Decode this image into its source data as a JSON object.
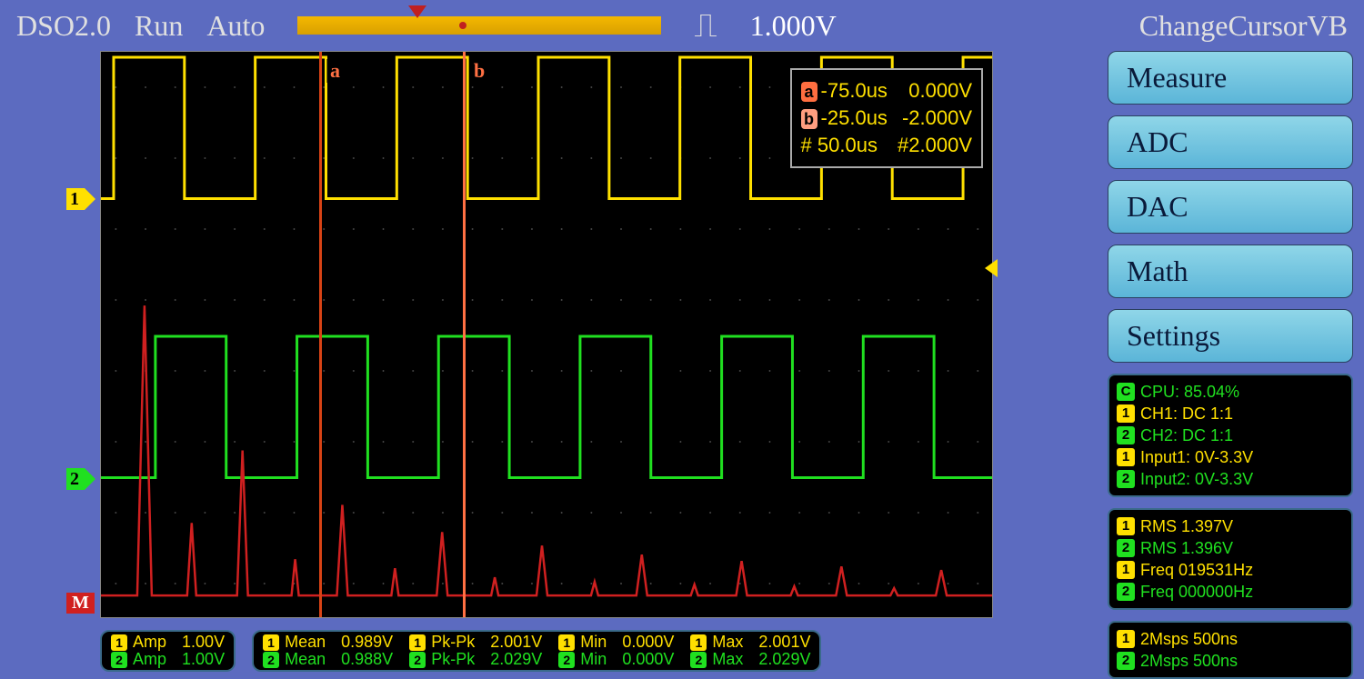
{
  "top": {
    "title": "DSO2.0",
    "run": "Run",
    "auto": "Auto",
    "trig_level": "1.000V",
    "cursor_mode": "ChangeCursorVB"
  },
  "side_buttons": {
    "measure": "Measure",
    "adc": "ADC",
    "dac": "DAC",
    "math": "Math",
    "settings": "Settings"
  },
  "cursors": {
    "a_label": "a",
    "b_label": "b",
    "a_time": "-75.0us",
    "a_volt": "0.000V",
    "b_time": "-25.0us",
    "b_volt": "-2.000V",
    "delta_time": "50.0us",
    "delta_volt": "#2.000V",
    "hash": "#"
  },
  "markers": {
    "ch1": "1",
    "ch2": "2",
    "math": "M"
  },
  "status_box": {
    "cpu": "CPU: 85.04%",
    "ch1": "CH1: DC 1:1",
    "ch2": "CH2: DC 1:1",
    "in1": "Input1: 0V-3.3V",
    "in2": "Input2: 0V-3.3V"
  },
  "meas_box": {
    "rms1": "RMS  1.397V",
    "rms2": "RMS  1.396V",
    "freq1": "Freq  019531Hz",
    "freq2": "Freq  000000Hz"
  },
  "rate_box": {
    "r1": "2Msps 500ns",
    "r2": "2Msps 500ns"
  },
  "bottom": {
    "amp": {
      "label": "Amp",
      "ch1": "1.00V",
      "ch2": "1.00V"
    },
    "mean": {
      "label": "Mean",
      "ch1": "0.989V",
      "ch2": "0.988V"
    },
    "pkpk": {
      "label": "Pk-Pk",
      "ch1": "2.001V",
      "ch2": "2.029V"
    },
    "min": {
      "label": "Min",
      "ch1": "0.000V",
      "ch2": "0.000V"
    },
    "max": {
      "label": "Max",
      "ch1": "2.001V",
      "ch2": "2.029V"
    }
  }
}
